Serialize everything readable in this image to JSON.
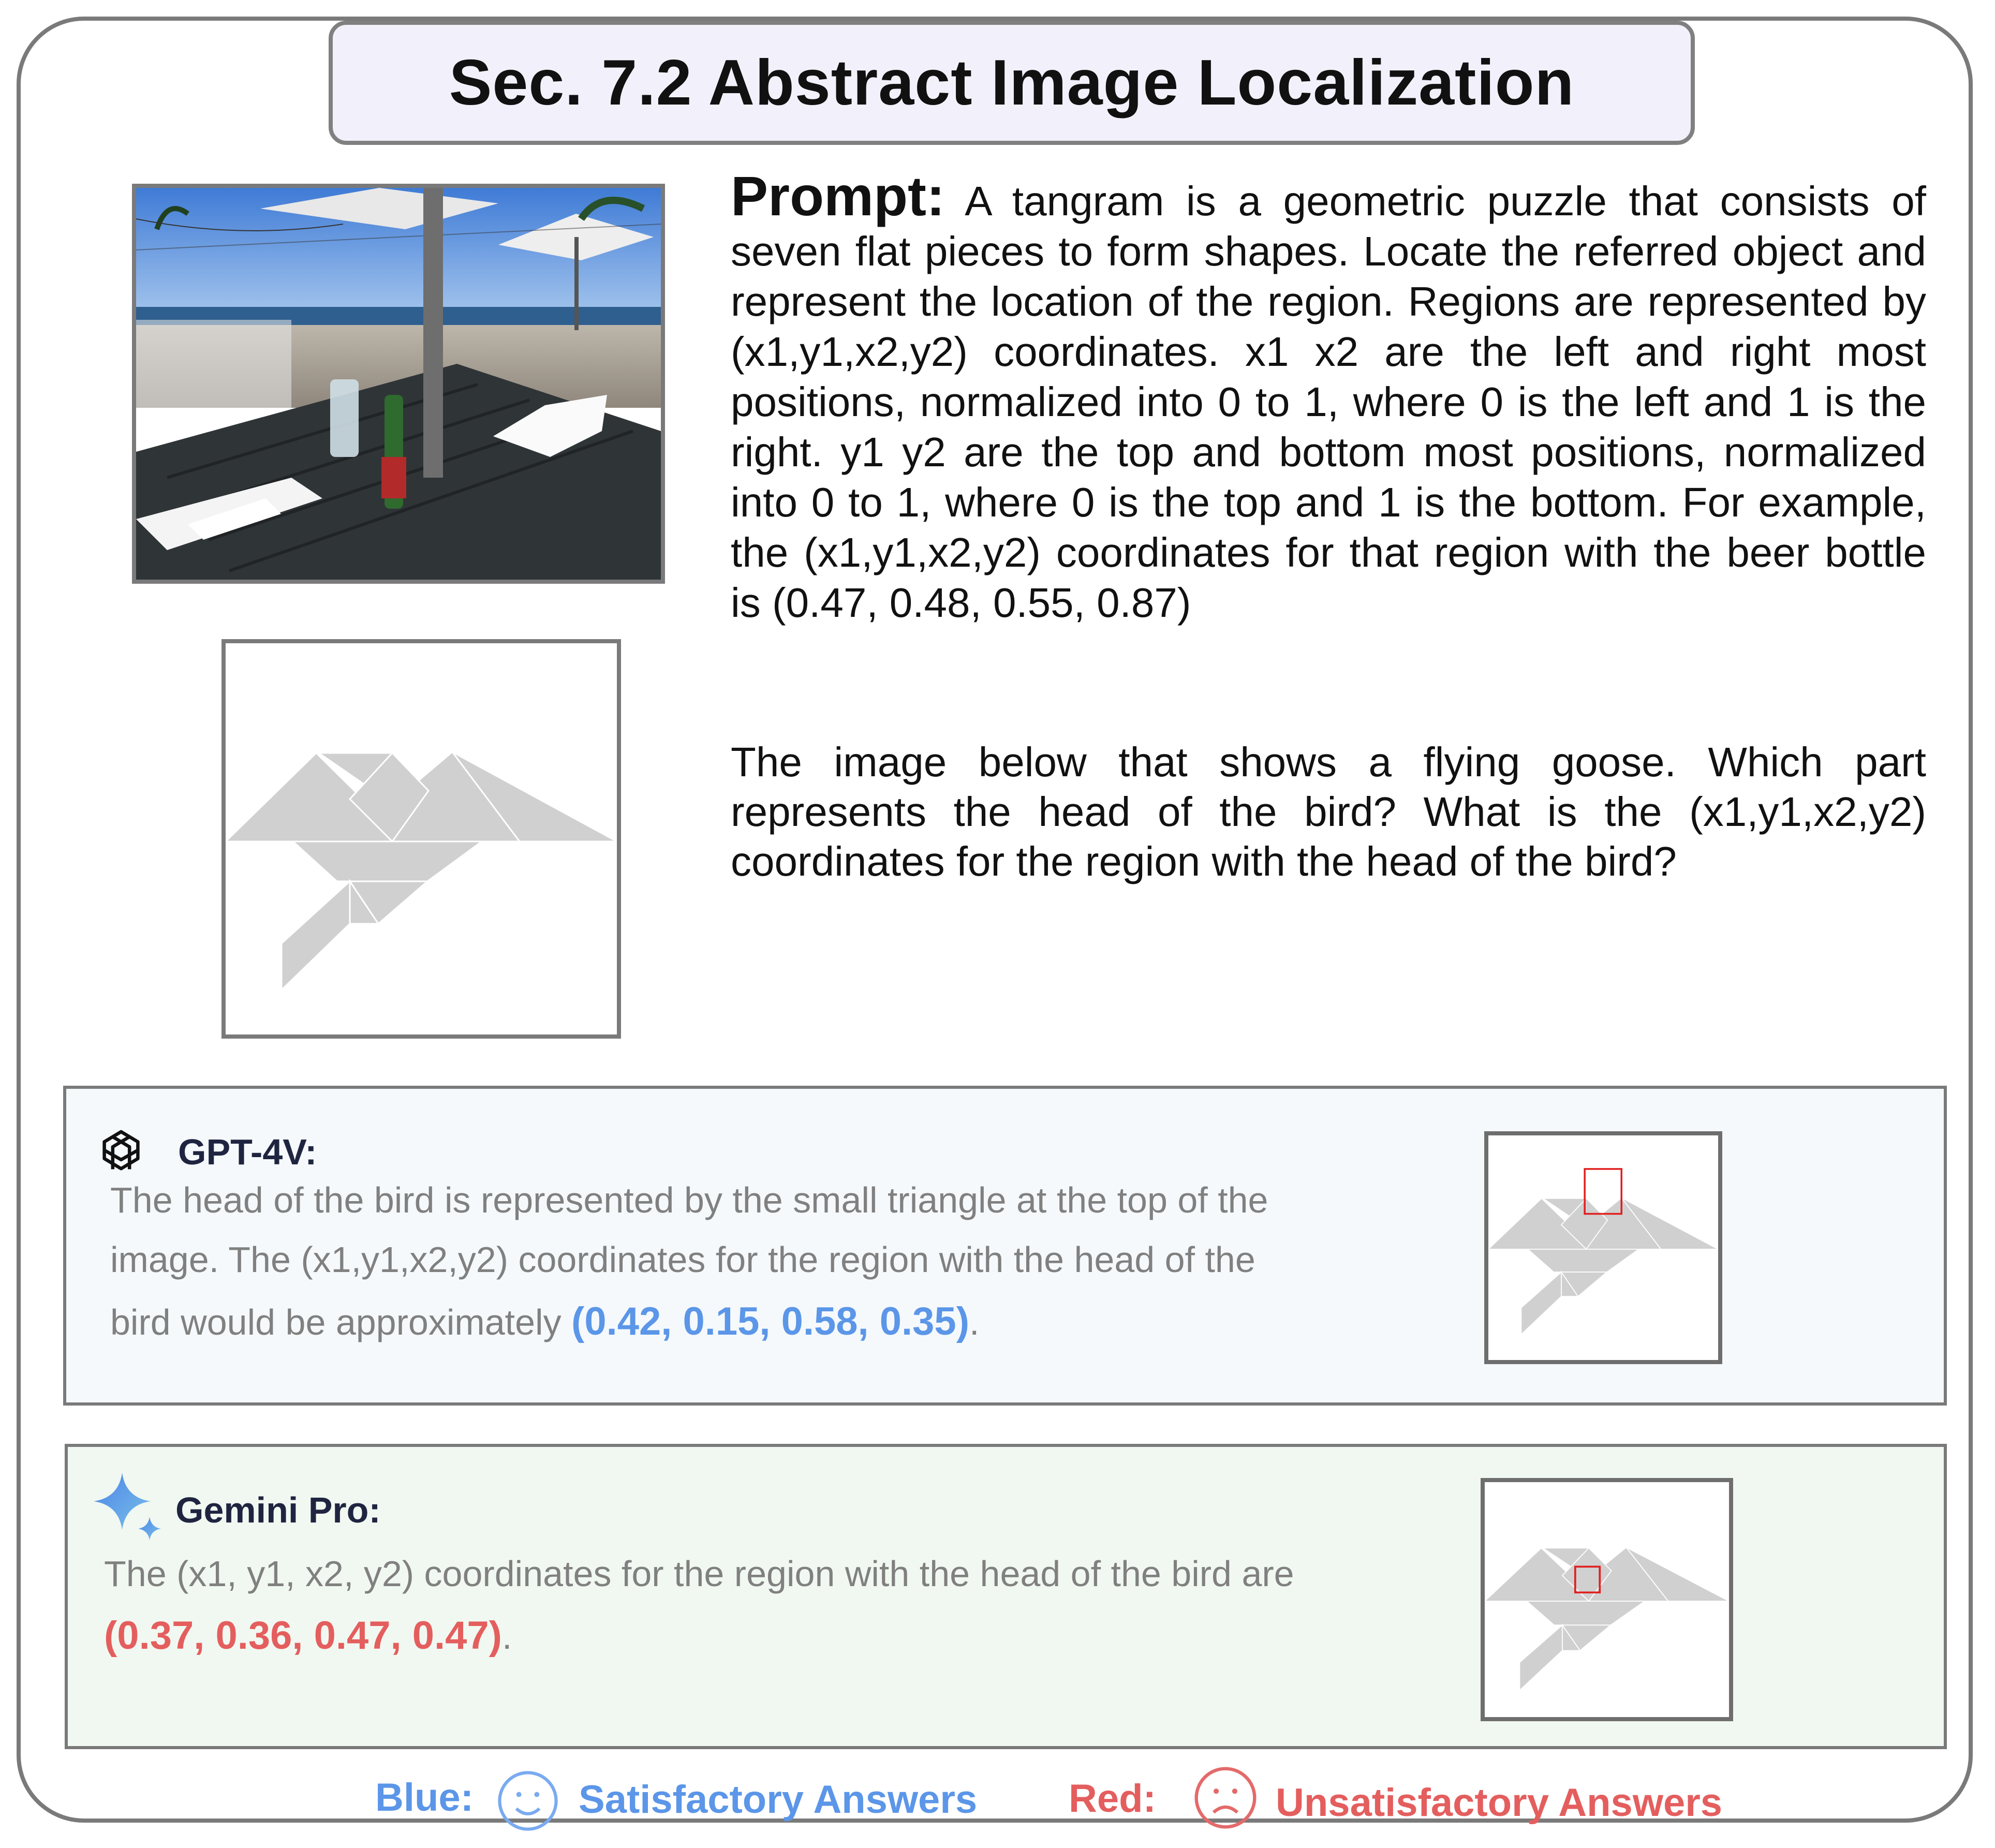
{
  "title": "Sec. 7.2 Abstract Image Localization",
  "prompt": {
    "label": "Prompt:",
    "text": "A tangram is a geometric puzzle that consists of seven flat pieces to form shapes. Locate the referred object and represent the location of the region. Regions are represented by (x1,y1,x2,y2) coordinates. x1 x2 are the left and right most positions, normalized into 0 to 1, where 0 is the left and 1 is the right. y1 y2 are the top and bottom most positions, normalized into 0 to 1, where 0 is the top and 1 is the bottom. For example, the (x1,y1,x2,y2) coordinates for that region with the beer bottle is (0.47, 0.48, 0.55, 0.87)",
    "question": "The image below that shows a flying goose. Which part represents the head of the bird? What is the (x1,y1,x2,y2) coordinates for the region with the head of the bird?"
  },
  "images": {
    "photo_icon": "beach-table-photo",
    "tangram_icon": "tangram-goose"
  },
  "responses": [
    {
      "model": "GPT-4V:",
      "icon": "openai-logo-icon",
      "text_line1": "The head of the bird is represented by the small triangle at the top of the",
      "text_line2": "image. The (x1,y1,x2,y2) coordinates for the region with the head of the",
      "text_line3_pre": "bird would be approximately ",
      "answer": "(0.42, 0.15, 0.58, 0.35)",
      "text_post": ".",
      "verdict_color": "#5b96e8"
    },
    {
      "model": "Gemini Pro:",
      "icon": "gemini-sparkle-icon",
      "text_line1": "The (x1, y1, x2, y2) coordinates for the region with the head of the bird are",
      "answer": "(0.37, 0.36, 0.47, 0.47)",
      "text_post": ".",
      "verdict_color": "#e45e5e"
    }
  ],
  "legend": {
    "blue_label": "Blue:",
    "blue_text": "Satisfactory Answers",
    "red_label": "Red:",
    "red_text": "Unsatisfactory Answers",
    "blue_color": "#5b96e8",
    "red_color": "#e45e5e"
  }
}
